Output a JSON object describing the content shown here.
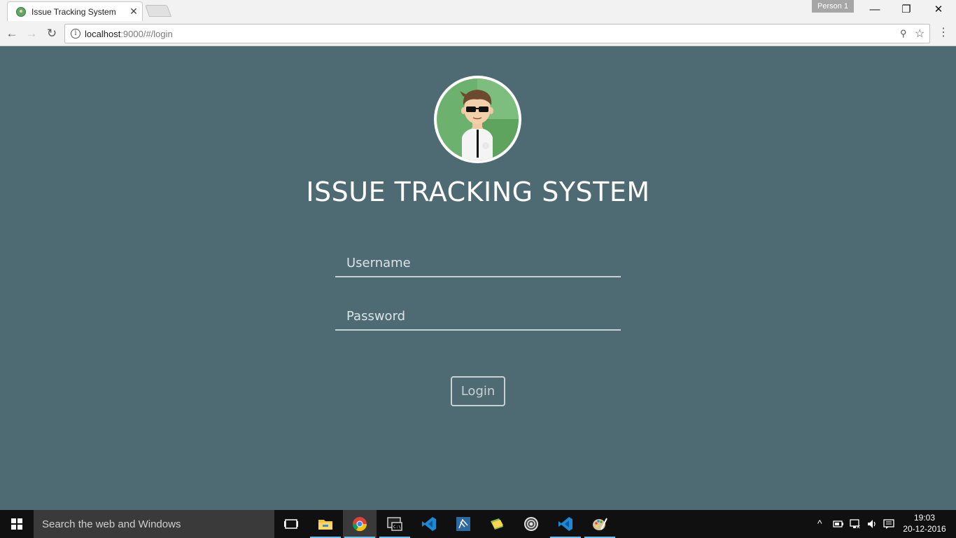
{
  "browser": {
    "tab": {
      "title": "Issue Tracking System",
      "close_glyph": "✕",
      "favicon": "avatar-favicon"
    },
    "profile": "Person 1",
    "window_controls": {
      "minimize": "—",
      "maximize": "❐",
      "close": "✕"
    },
    "nav": {
      "back": "←",
      "forward": "→",
      "reload": "↻"
    },
    "url": {
      "host": "localhost",
      "path": ":9000/#/login"
    },
    "icons": {
      "info": "i",
      "pin": "⚲",
      "star": "☆",
      "menu": "⋮"
    }
  },
  "login": {
    "title": "ISSUE TRACKING SYSTEM",
    "username_placeholder": "Username",
    "password_placeholder": "Password",
    "button_label": "Login",
    "colors": {
      "background": "#4e6a73",
      "accent": "#c7d1d4",
      "avatar": "#6db16e"
    }
  },
  "taskbar": {
    "search_placeholder": "Search the web and Windows",
    "apps": [
      "task-view",
      "file-explorer",
      "chrome",
      "command-prompt",
      "visual-studio-code",
      "visual-studio",
      "sticky-notes",
      "eclipse",
      "visual-studio-2",
      "paint"
    ],
    "tray": {
      "show_hidden": "^",
      "clock_time": "19:03",
      "clock_date": "20-12-2016"
    }
  }
}
